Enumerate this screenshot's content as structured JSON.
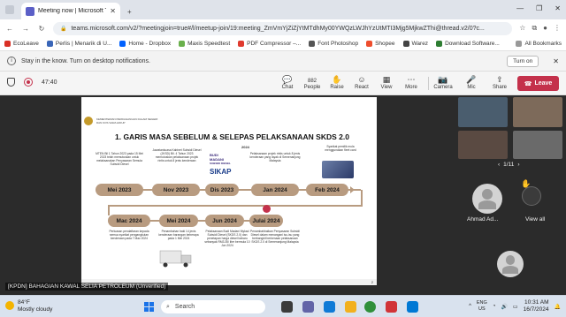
{
  "browser": {
    "tab_title": "Meeting now | Microsoft Te",
    "tab_close": "✕",
    "new_tab": "+",
    "controls": [
      "—",
      "❐",
      "✕"
    ],
    "url": "teams.microsoft.com/v2/?meetingjoin=true#/l/meetup-join/19:meeting_ZmVmYjZiZjYtMTdhMy00YWQzLWJhYzUtMTI3Mjg5MjkwZThi@thread.v2/0?c...",
    "nav": {
      "back": "←",
      "forward": "→",
      "reload": "↻"
    }
  },
  "bookmarks": {
    "items": [
      {
        "label": "EcoLeave",
        "color": "#d93025"
      },
      {
        "label": "Perlis | Menarik di U...",
        "color": "#3a66b8"
      },
      {
        "label": "Home - Dropbox",
        "color": "#0061fe"
      },
      {
        "label": "Maxis Speedtest",
        "color": "#6ab04c"
      },
      {
        "label": "PDF Compressor –...",
        "color": "#e03b2f"
      },
      {
        "label": "Font Photoshop",
        "color": "#555555"
      },
      {
        "label": "Shopee",
        "color": "#ee4d2d"
      },
      {
        "label": "Warez",
        "color": "#444444"
      },
      {
        "label": "Download Software...",
        "color": "#2e7d32"
      }
    ],
    "all": "All Bookmarks"
  },
  "notification": {
    "text": "Stay in the know. Turn on desktop notifications.",
    "button": "Turn on",
    "close": "✕"
  },
  "meeting": {
    "timer": "47:40",
    "people_count": "882",
    "tools": [
      {
        "label": "Chat",
        "icon": "chat-icon",
        "glyph": "💬"
      },
      {
        "label": "People",
        "icon": "people-icon",
        "glyph": "👥"
      },
      {
        "label": "Raise",
        "icon": "raise-hand-icon",
        "glyph": "✋"
      },
      {
        "label": "React",
        "icon": "react-icon",
        "glyph": "☺"
      },
      {
        "label": "View",
        "icon": "view-icon",
        "glyph": "▦"
      },
      {
        "label": "More",
        "icon": "more-icon",
        "glyph": "⋯"
      }
    ],
    "devices": [
      {
        "label": "Camera",
        "icon": "camera-off-icon",
        "glyph": "📷"
      },
      {
        "label": "Mic",
        "icon": "mic-off-icon",
        "glyph": "🎤"
      },
      {
        "label": "Share",
        "icon": "share-icon",
        "glyph": "⇪"
      }
    ],
    "leave": "Leave",
    "presenter": "[KPDN] BAHAGIAN KAWAL SELIA PETROLEUM (Unverified)"
  },
  "slide": {
    "header": [
      "KEMENTERIAN PERDAGANGAN DALAM NEGERI",
      "DAN KOS SARA HIDUP"
    ],
    "title": "1. GARIS MASA SEBELUM & SELEPAS PELAKSANAAN SKDS 2.0",
    "year_tag": "2024",
    "page": "2",
    "row1": [
      "Mei 2023",
      "Nov 2023",
      "Dis 2023",
      "Jan 2024",
      "Feb 2024"
    ],
    "row2": [
      "Mac 2024",
      "Mei 2024",
      "Jun 2024",
      "Julai 2024"
    ],
    "notes": {
      "mei2023": "MTEN Bil 1 Tahun 2023 pada 15 Mei 2023 telah memutuskan untuk melaksanakan Penyasaran Semula Subsidi Diesel",
      "nov2023": "Jawatankuasa Kabinet Subsidi Diesel (JKSD) Bil. 4 Tahun 2023 memutuskan pelaksanaan projek rintis untuk 8 jenis kenderaan",
      "jan2024": "Pelaksanaan projek rintis untuk 8 jenis kenderaan yang layak di Semenanjung Malaysia",
      "feb2024": "Syarikat pemilik mula menggunakan fleet card",
      "mac2024": "Perluasan pendaftaran kepada semua syarikat pengangkutan kenderaan pada 7 Mac 2024",
      "mei2024": "Penambahan baki 14 jenis kenderaan barangan beberapa pada 1 Mei 2024",
      "jun2024": "Pelaksanaan Budi Madani Mykad Subsidi Diesel (SKDS 2.0) dan penetapan harga diesel baharu sebanyak RM3.35/ liter bermula 10 Jun 2024",
      "julai2024": "Penambahbaikan Penyasaran Subsidi Diesel dalam menangani isu-isu yang berbangkit berkenaan pelaksanaan SKDS 2.0 di Semenanjung Malaysia"
    },
    "logos": {
      "budi_line1": "BUDI",
      "budi_line2": "MADANI",
      "budi_line3": "SUBSIDI DIESEL",
      "sikap": "SIKAP"
    }
  },
  "gallery": {
    "pager": "1/11",
    "pager_prev": "‹",
    "pager_next": "›",
    "participant": "Ahmad Ad...",
    "view_all": "View all",
    "hand": "✋"
  },
  "taskbar": {
    "temp": "84°F",
    "weather": "Mostly cloudy",
    "search": "Search",
    "lang_top": "ENG",
    "lang_bottom": "US",
    "time": "10:31 AM",
    "date": "16/7/2024"
  }
}
